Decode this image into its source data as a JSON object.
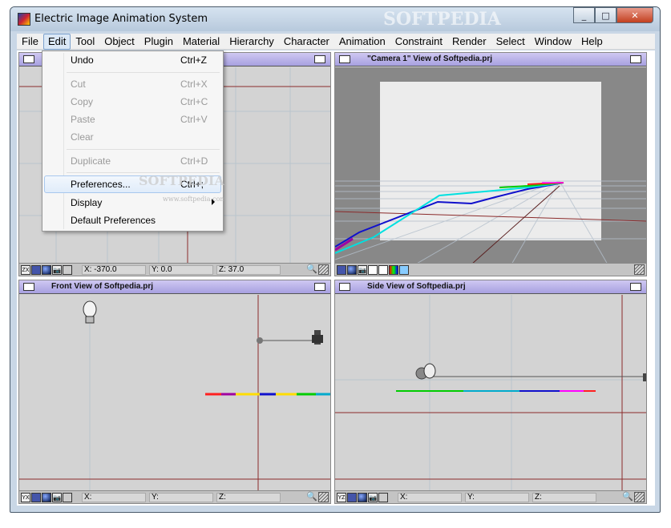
{
  "window": {
    "title": "Electric Image Animation System",
    "watermark": "SOFTPEDIA"
  },
  "window_buttons": {
    "minimize": "_",
    "maximize": "□",
    "close": "✕"
  },
  "menubar": [
    "File",
    "Edit",
    "Tool",
    "Object",
    "Plugin",
    "Material",
    "Hierarchy",
    "Character",
    "Animation",
    "Constraint",
    "Render",
    "Select",
    "Window",
    "Help"
  ],
  "edit_menu": {
    "items": [
      {
        "label": "Undo",
        "shortcut": "Ctrl+Z",
        "disabled": false
      },
      {
        "label": "Cut",
        "shortcut": "Ctrl+X",
        "disabled": true
      },
      {
        "label": "Copy",
        "shortcut": "Ctrl+C",
        "disabled": true
      },
      {
        "label": "Paste",
        "shortcut": "Ctrl+V",
        "disabled": true
      },
      {
        "label": "Clear",
        "shortcut": "",
        "disabled": true
      },
      {
        "label": "Duplicate",
        "shortcut": "Ctrl+D",
        "disabled": true
      },
      {
        "label": "Preferences...",
        "shortcut": "Ctrl+;",
        "disabled": false
      },
      {
        "label": "Display",
        "shortcut": "",
        "disabled": false,
        "submenu": true
      },
      {
        "label": "Default Preferences",
        "shortcut": "",
        "disabled": false
      }
    ],
    "watermark": "SOFTPEDIA",
    "watermark_url": "www.softpedia.com"
  },
  "viewports": {
    "top": {
      "title": "",
      "x": "X: -370.0",
      "y": "Y: 0.0",
      "z": "Z: 37.0",
      "axis": "ZX"
    },
    "camera": {
      "title": "\"Camera 1\" View of Softpedia.prj"
    },
    "front": {
      "title": "Front View of Softpedia.prj",
      "x": "X:",
      "y": "Y:",
      "z": "Z:",
      "axis": "YX"
    },
    "side": {
      "title": "Side View of Softpedia.prj",
      "x": "X:",
      "y": "Y:",
      "z": "Z:",
      "axis": "YZ"
    }
  },
  "colors": {
    "viewport_bg": "#d3d3d3",
    "grid": "#b9c4cc",
    "axis": "#8b2b2b",
    "titlebar": "#b1aae6"
  }
}
